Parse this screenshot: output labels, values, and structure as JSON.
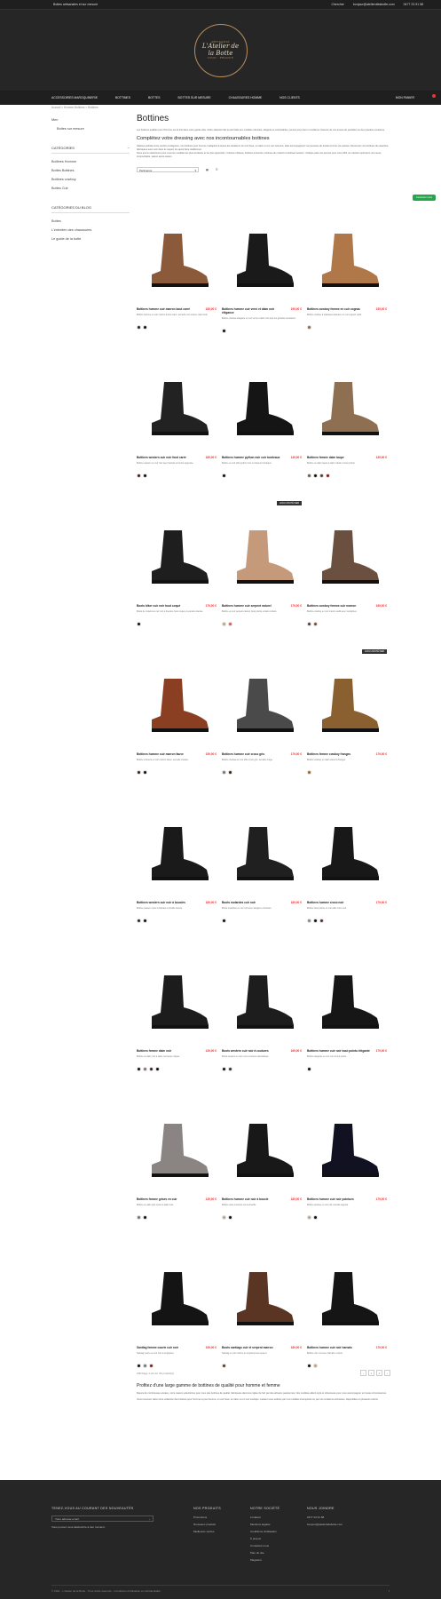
{
  "topbar": {
    "tagline": "Bottes artisanales et sur mesure",
    "search": "Chercher",
    "email": "bonjour@atelierdelabotte.com",
    "phone": "0477 23 91 58"
  },
  "logo": {
    "top": "ARTISANAT",
    "line1": "L'Atelier de",
    "line2": "la Botte",
    "bottom": "LYON · FRANCE"
  },
  "nav": [
    "ACCESSOIRES MAROQUINERIE",
    "BOTTINES",
    "BOTTES",
    "BOTTES SUR MESURE",
    "CHAUSSURES HOMME",
    "NOS CLIENTS"
  ],
  "cart": "MON PANIER",
  "breadcrumb": "Accueil  >  Homme Bottines  >  Bottines",
  "sidebar": {
    "items": [
      "Men",
      "Bottes sur mesure"
    ],
    "categories_title": "CATÉGORIES",
    "categories": [
      "Bottines Homme",
      "Bottes Bottines",
      "Bottines cowboy",
      "Bottes Cuir"
    ],
    "blog_title": "CATÉGORIES DU BLOG",
    "blog": [
      "Bottes",
      "L'entretien des chaussures",
      "Le guide de la botte"
    ]
  },
  "page": {
    "title": "Bottines",
    "intro": "Les bottines qualités pour l'homme sur la fois dans votre garde-robe. Notre sélection fait la part belle aux modèles robustes, élégants et confortables, pensés pour durer et sublimer chacune de vos tenues du quotidien ou des grandes occasions.",
    "subtitle": "Complétez votre dressing avec nos incontournables bottines",
    "intro2": "Alliance parfaite entre confort et élégance, nos bottines pour homme s'adaptent à toutes les situations. En cuir lisse, en daim ou en cuir retourné, elles accompagnent vos journées de travail comme vos soirées. Découvrez nos bottines de caractère, fabriquées avec soin dans le respect du savoir-faire traditionnel.",
    "intro3": "Nous avons sélectionné pour vous les modèles les plus tendance et les plus appréciés : bottines chelsea, bottines à boucles, bottines de motard ou bottines western. Chaque paire est pensée pour vous offrir un maintien optimal et une tenue irréprochable, saison après saison.",
    "sort_label": "Pertinence",
    "sort_prefix": "Trier par"
  },
  "products": [
    {
      "name": "Bottines homme cuir marron bout carré",
      "price": "189,00 €",
      "desc": "Bottine homme en cuir marron à bout carré, semelle cuir cousue, talon bois.",
      "colors": [
        "#3b2314",
        "#111111"
      ],
      "shoe": "#8a5a3b",
      "tag": ""
    },
    {
      "name": "Bottines homme cuir verni et daim noir élégance",
      "price": "199,00 €",
      "desc": "Bottine chelsea élégante en cuir verni et daim noir pour les grandes occasions.",
      "colors": [
        "#111111"
      ],
      "shoe": "#1a1a1a",
      "tag": ""
    },
    {
      "name": "Bottines cowboy femme en cuir cognac",
      "price": "159,00 €",
      "desc": "Bottine cowboy à élastiques latéraux en cuir cognac vieilli.",
      "colors": [
        "#a0642d"
      ],
      "shoe": "#b07849",
      "tag": ""
    },
    {
      "name": "Bottines western cuir noir fond carré",
      "price": "189,00 €",
      "desc": "Bottine western en cuir noir avec harnais et boucle argentée.",
      "colors": [
        "#3b2314",
        "#111111"
      ],
      "shoe": "#222222",
      "tag": ""
    },
    {
      "name": "Bottines homme python noir cuir bordeaux",
      "price": "149,00 €",
      "desc": "Bottine en cuir effet python noir et intérieur bordeaux.",
      "colors": [
        "#111111"
      ],
      "shoe": "#151515",
      "tag": ""
    },
    {
      "name": "Bottines femme daim taupe",
      "price": "139,00 €",
      "desc": "Bottine en daim taupe à talon cubain et bout pointu.",
      "colors": [
        "#6e5a4a",
        "#111111",
        "#5a3a2a",
        "#7a1f1f"
      ],
      "shoe": "#8f6f52",
      "tag": ""
    },
    {
      "name": "Boots biker cuir noir bout coqué",
      "price": "179,00 €",
      "desc": "Boots de motard en cuir noir à boucles, bout coqué et semelle crantée.",
      "colors": [
        "#111111"
      ],
      "shoe": "#1e1e1e",
      "tag": ""
    },
    {
      "name": "Bottines homme cuir serpent naturel",
      "price": "179,00 €",
      "desc": "Bottine en cuir serpent naturel, bout pointu et talon cubain.",
      "colors": [
        "#c9a37a",
        "#d06060"
      ],
      "shoe": "#c49a7a",
      "tag": "EXCLUSIVITÉ WEB"
    },
    {
      "name": "Bottines cowboy femme cuir marron",
      "price": "169,00 €",
      "desc": "Bottine cowboy en cuir marron vieilli avec surpiqûres.",
      "colors": [
        "#5a3a2a",
        "#7a4a2a"
      ],
      "shoe": "#6b5040",
      "tag": ""
    },
    {
      "name": "Bottines homme cuir marron fauve",
      "price": "159,00 €",
      "desc": "Bottine à boucle en cuir marron fauve, semelle crantée.",
      "colors": [
        "#3b2314",
        "#111111"
      ],
      "shoe": "#8a3e22",
      "tag": ""
    },
    {
      "name": "Bottines homme cuir croco gris",
      "price": "179,00 €",
      "desc": "Bottine chelsea en cuir effet croco gris, semelle rouge.",
      "colors": [
        "#777777",
        "#3b2314"
      ],
      "shoe": "#4a4a4a",
      "tag": ""
    },
    {
      "name": "Bottines femme cowboy franges",
      "price": "179,00 €",
      "desc": "Bottine cowboy en daim camel à franges.",
      "colors": [
        "#a0642d"
      ],
      "shoe": "#8a6030",
      "tag": "EXCLUSIVITÉ WEB"
    },
    {
      "name": "Bottines western cuir noir à boucles",
      "price": "189,00 €",
      "desc": "Bottine western noire à harnais et double boucle.",
      "colors": [
        "#3b2314",
        "#111111"
      ],
      "shoe": "#1a1a1a",
      "tag": ""
    },
    {
      "name": "Boots motardes cuir noir",
      "price": "189,00 €",
      "desc": "Boots motardes en cuir noir avec sangles et boucles.",
      "colors": [
        "#111111"
      ],
      "shoe": "#202020",
      "tag": ""
    },
    {
      "name": "Bottines homme croco noir",
      "price": "179,00 €",
      "desc": "Bottine bout pointu en cuir effet croco noir.",
      "colors": [
        "#888888",
        "#111111",
        "#7a1f1f"
      ],
      "shoe": "#181818",
      "tag": ""
    },
    {
      "name": "Bottines femme daim noir",
      "price": "139,00 €",
      "desc": "Bottine en daim noir à talon, fermeture zippée.",
      "colors": [
        "#111111",
        "#777777",
        "#3b2314",
        "#111111"
      ],
      "shoe": "#1c1c1c",
      "tag": ""
    },
    {
      "name": "Boots western cuir noir à coutures",
      "price": "169,00 €",
      "desc": "Boots western en cuir noir à coutures décoratives.",
      "colors": [
        "#111111",
        "#333333"
      ],
      "shoe": "#1d1d1d",
      "tag": ""
    },
    {
      "name": "Bottines homme cuir noir bout pointu élégante",
      "price": "179,00 €",
      "desc": "Bottine élégante en cuir noir à bout pointu.",
      "colors": [
        "#111111"
      ],
      "shoe": "#161616",
      "tag": ""
    },
    {
      "name": "Bottines femme grises en cuir",
      "price": "139,00 €",
      "desc": "Bottine en daim gris souris à talon bois.",
      "colors": [
        "#777777",
        "#111111"
      ],
      "shoe": "#8a8582",
      "tag": ""
    },
    {
      "name": "Bottines homme cuir noir à boucle",
      "price": "189,00 €",
      "desc": "Bottine noire à boucle sur la cheville.",
      "colors": [
        "#c9a37a",
        "#111111"
      ],
      "shoe": "#181818",
      "tag": ""
    },
    {
      "name": "Bottines homme cuir noir pointues",
      "price": "179,00 €",
      "desc": "Bottine pointue en cuir noir, harnais argenté.",
      "colors": [
        "#c9a37a",
        "#111111"
      ],
      "shoe": "#111122",
      "tag": ""
    },
    {
      "name": "Santiag femme courte cuir noir",
      "price": "159,00 €",
      "desc": "Santiag courte en cuir noir à surpiqûres.",
      "colors": [
        "#111111",
        "#777777",
        "#7a1f1f"
      ],
      "shoe": "#141414",
      "tag": ""
    },
    {
      "name": "Boots santiags cuir et serpent marron",
      "price": "189,00 €",
      "desc": "Santiag en cuir marron et empiècement serpent.",
      "colors": [
        "#5a3a2a"
      ],
      "shoe": "#5a3524",
      "tag": ""
    },
    {
      "name": "Bottines homme cuir noir harnais",
      "price": "179,00 €",
      "desc": "Bottine cuir noir avec harnais et clous.",
      "colors": [
        "#111111",
        "#c9a37a"
      ],
      "shoe": "#151515",
      "tag": ""
    }
  ],
  "pagination": {
    "info": "Affichage 1-24 sur 36 produit(s)",
    "pages": [
      "‹",
      "1",
      "2",
      "›"
    ]
  },
  "seo": {
    "title": "Profitez d'une large gamme de bottines de qualité pour homme et femme",
    "p1": "Depuis de nombreuses années, notre maison sélectionne pour vous des bottines de qualité, fabriquées dans les règles de l'art par des artisans passionnés. Nos modèles allient style et robustesse pour vous accompagner en toutes circonstances.",
    "p2": "Vous trouverez dans notre collection des bottines pour homme et pour femme, en cuir lisse, en daim ou en cuir exotique. Laissez-vous séduire par nos modèles intemporels ou par nos créations exclusives, disponibles en plusieurs coloris."
  },
  "footer": {
    "newsletter_title": "TENEZ-VOUS AU COURANT DES NOUVEAUTÉS",
    "newsletter_placeholder": "Votre adresse email",
    "newsletter_note": "Vous pouvez vous désinscrire à tout moment.",
    "col1_title": "NOS PRODUITS",
    "col1": [
      "Promotions",
      "Nouveaux produits",
      "Meilleures ventes"
    ],
    "col2_title": "NOTRE SOCIÉTÉ",
    "col2": [
      "Livraison",
      "Mentions légales",
      "Conditions d'utilisation",
      "À propos",
      "Contactez-nous",
      "Plan du site",
      "Magasins"
    ],
    "col3_title": "NOUS JOINDRE",
    "col3": [
      "0477 23 91 58",
      "bonjour@atelierdelabotte.com"
    ],
    "copyright": "© 2021 · L'Atelier de la Botte · Tous droits réservés · Conditions d'utilisation et confidentialité"
  },
  "contact_badge": "Contactez-nous"
}
